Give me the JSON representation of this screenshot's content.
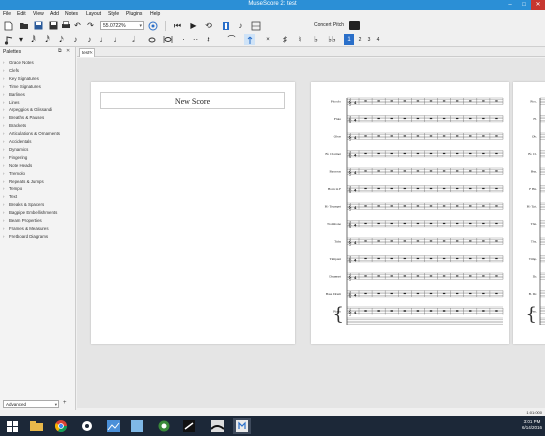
{
  "app": {
    "title": "MuseScore 2: test"
  },
  "menu": [
    "File",
    "Edit",
    "View",
    "Add",
    "Notes",
    "Layout",
    "Style",
    "Plugins",
    "Help"
  ],
  "toolbar": {
    "zoom_value": "55.0722%",
    "concert_pitch_label": "Concert Pitch",
    "voices": [
      "1",
      "2",
      "3",
      "4"
    ]
  },
  "palettes": {
    "title": "Palettes",
    "items": [
      "Grace Notes",
      "Clefs",
      "Key Signatures",
      "Time Signatures",
      "Barlines",
      "Lines",
      "Arpeggios & Glissandi",
      "Breaths & Pauses",
      "Brackets",
      "Articulations & Ornaments",
      "Accidentals",
      "Dynamics",
      "Fingering",
      "Note Heads",
      "Tremolo",
      "Repeats & Jumps",
      "Tempo",
      "Text",
      "Breaks & Spacers",
      "Bagpipe Embellishments",
      "Beam Properties",
      "Frames & Measures",
      "Fretboard Diagrams"
    ],
    "workspace": "Advanced"
  },
  "tabs": [
    {
      "label": "test*"
    }
  ],
  "score": {
    "title": "New Score",
    "instruments": [
      "Piccolo",
      "Flute",
      "Oboe",
      "B♭ Clarinet",
      "Bassoon",
      "Horn in F",
      "B♭ Trumpet",
      "Trombone",
      "Tuba",
      "Timpani",
      "Drumset",
      "Bass Drum",
      "Piano"
    ],
    "instruments_short": [
      "Picc.",
      "Fl.",
      "Ob.",
      "B♭ Cl.",
      "Bsn.",
      "F Hn.",
      "B♭ Tpt.",
      "Tbn.",
      "Tba.",
      "Timp.",
      "Dr.",
      "B. Dr.",
      "Pno."
    ]
  },
  "statusbar": {
    "position": "1:01:000"
  },
  "taskbar": {
    "time": "3:01 PM",
    "date": "6/14/2016"
  },
  "colors": {
    "titlebar": "#2b8fd6",
    "taskbar": "#1c2838",
    "canvas": "#e5e5e5",
    "accent_blue": "#2a6fc9"
  }
}
